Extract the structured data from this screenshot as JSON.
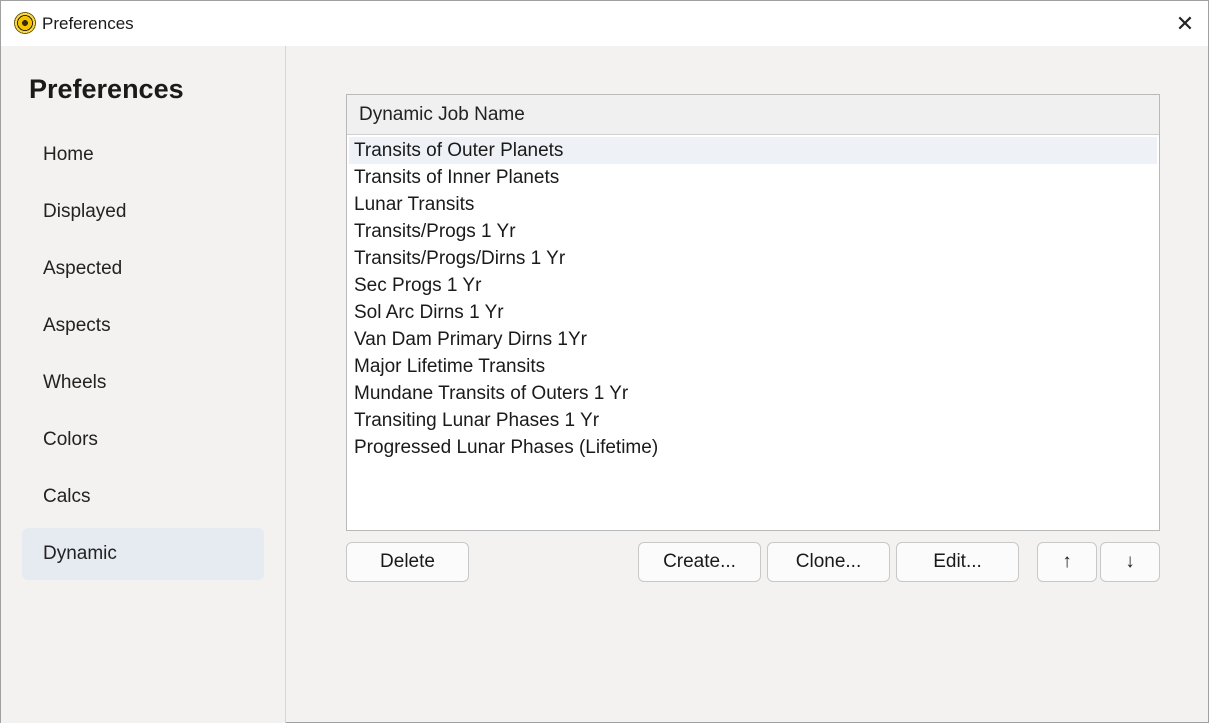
{
  "window": {
    "title": "Preferences",
    "close_glyph": "✕"
  },
  "sidebar": {
    "title": "Preferences",
    "items": [
      {
        "label": "Home"
      },
      {
        "label": "Displayed"
      },
      {
        "label": "Aspected"
      },
      {
        "label": "Aspects"
      },
      {
        "label": "Wheels"
      },
      {
        "label": "Colors"
      },
      {
        "label": "Calcs"
      },
      {
        "label": "Dynamic",
        "active": true
      }
    ]
  },
  "list": {
    "header": "Dynamic Job Name",
    "rows": [
      "Transits of Outer Planets",
      "Transits of Inner Planets",
      "Lunar Transits",
      "Transits/Progs 1 Yr",
      "Transits/Progs/Dirns 1 Yr",
      "Sec Progs 1 Yr",
      "Sol Arc Dirns 1 Yr",
      "Van Dam Primary Dirns 1Yr",
      "Major Lifetime Transits",
      "Mundane Transits of Outers 1 Yr",
      "Transiting Lunar Phases 1 Yr",
      "Progressed Lunar Phases (Lifetime)"
    ],
    "selected_index": 0
  },
  "buttons": {
    "delete": "Delete",
    "create": "Create...",
    "clone": "Clone...",
    "edit": "Edit...",
    "up": "↑",
    "down": "↓"
  }
}
